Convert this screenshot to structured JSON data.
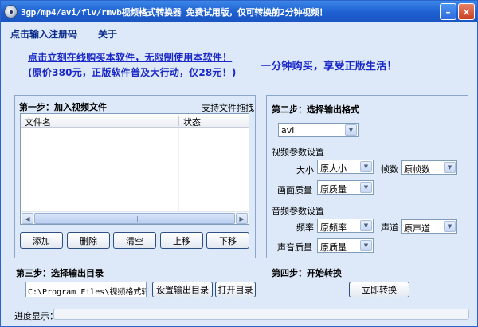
{
  "window": {
    "title": "3gp/mp4/avi/flv/rmvb视频格式转换器   免费试用版，仅可转换前2分钟视频！",
    "minimize_label": "–",
    "close_label": "×",
    "app_icon": "disc-icon"
  },
  "menu": {
    "register": "点击输入注册码",
    "about": "关于"
  },
  "promo": {
    "line1": "点击立刻在线购买本软件，无限制使用本软件！",
    "line2": "(原价380元，正版软件普及大行动，仅28元！)",
    "slogan": "一分钟购买，享受正版生活！"
  },
  "step1": {
    "title": "第一步：加入视频文件",
    "drag_hint": "支持文件拖拽",
    "columns": [
      "文件名",
      "状态"
    ],
    "rows": [],
    "buttons": {
      "add": "添加",
      "delete": "删除",
      "clear": "清空",
      "up": "上移",
      "down": "下移"
    }
  },
  "step2": {
    "title": "第二步：选择输出格式",
    "format": "avi",
    "video_section": "视频参数设置",
    "size_label": "大小",
    "size_value": "原大小",
    "framerate_label": "帧数",
    "framerate_value": "原帧数",
    "video_quality_label": "画面质量",
    "video_quality_value": "原质量",
    "audio_section": "音频参数设置",
    "samplerate_label": "频率",
    "samplerate_value": "原频率",
    "channel_label": "声道",
    "channel_value": "原声道",
    "audio_quality_label": "声音质量",
    "audio_quality_value": "原质量"
  },
  "step3": {
    "title": "第三步：选择输出目录",
    "path": "C:\\Program Files\\视频格式转换器",
    "set_dir_button": "设置输出目录",
    "open_dir_button": "打开目录"
  },
  "step4": {
    "title": "第四步：开始转换",
    "convert_button": "立即转换"
  },
  "progress": {
    "label": "进度显示：",
    "value": 0
  }
}
